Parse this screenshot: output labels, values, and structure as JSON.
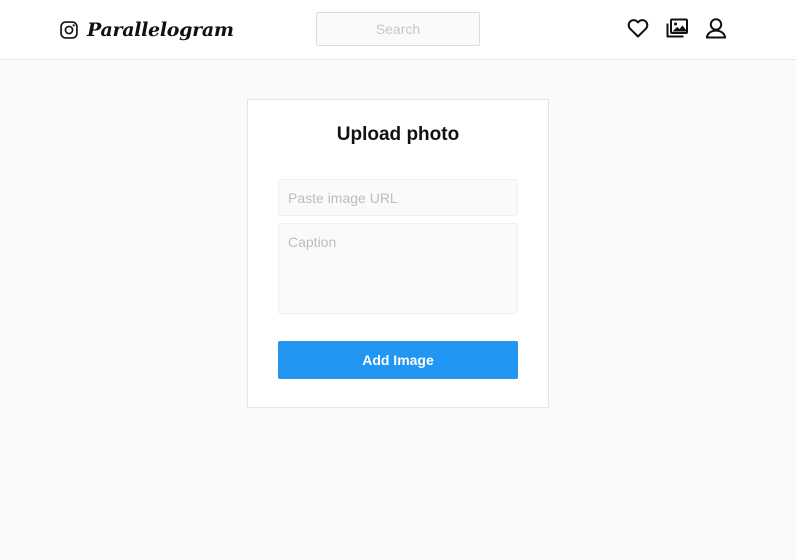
{
  "header": {
    "brand_name": "Parallelogram",
    "brand_icon": "instagram-icon",
    "search": {
      "placeholder": "Search",
      "value": ""
    },
    "nav_icons": [
      "heart-icon",
      "gallery-icon",
      "user-icon"
    ]
  },
  "upload_form": {
    "title": "Upload photo",
    "url_field": {
      "placeholder": "Paste image URL",
      "value": ""
    },
    "caption_field": {
      "placeholder": "Caption",
      "value": ""
    },
    "submit_label": "Add Image"
  },
  "colors": {
    "accent": "#2196f3",
    "background": "#fafafa",
    "surface": "#ffffff",
    "border": "#e6e6e6"
  }
}
